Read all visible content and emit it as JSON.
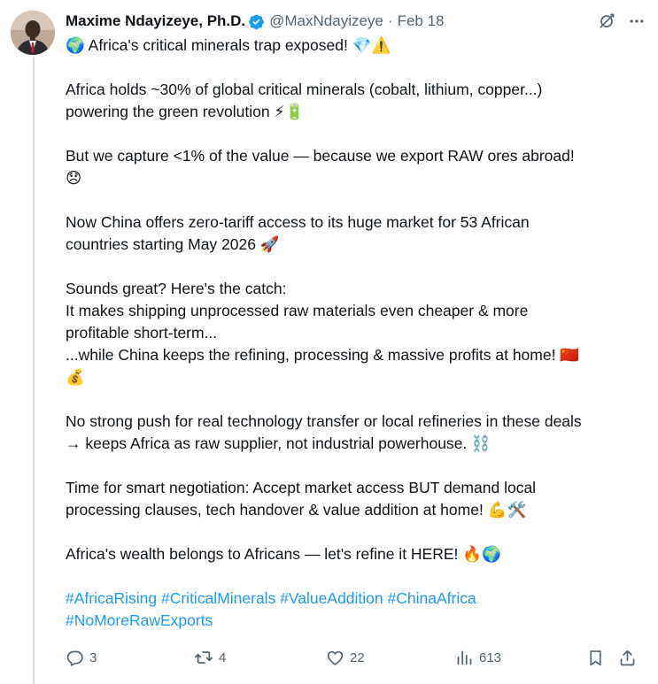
{
  "tweet": {
    "author": {
      "name": "Maxime Ndayizeye, Ph.D.",
      "handle": "@MaxNdayizeye",
      "verified": true
    },
    "separator": "·",
    "date": "Feb 18",
    "paragraphs": [
      [
        "🌍 Africa's critical minerals trap exposed! 💎⚠️"
      ],
      [
        "Africa holds ~30% of global critical minerals (cobalt, lithium, copper...)",
        "powering the green revolution ⚡🔋"
      ],
      [
        "But we capture <1% of the value — because we export RAW ores abroad!",
        "😞"
      ],
      [
        "Now China offers zero-tariff access to its huge market for 53 African",
        "countries starting May 2026 🚀"
      ],
      [
        "Sounds great? Here's the catch:",
        "It makes shipping unprocessed raw materials even cheaper & more",
        "profitable short-term...",
        "...while China keeps the refining, processing & massive profits at home! 🇨🇳",
        "💰"
      ],
      [
        "No strong push for real technology transfer or local refineries in these deals",
        "→ keeps Africa as raw supplier, not industrial powerhouse. ⛓️"
      ],
      [
        "Time for smart negotiation: Accept market access BUT demand local",
        "processing clauses, tech handover & value addition at home! 💪🛠️"
      ],
      [
        "Africa's wealth belongs to Africans — let's refine it HERE! 🔥🌍"
      ]
    ],
    "hashtags": {
      "line1": [
        "#AfricaRising",
        "#CriticalMinerals",
        "#ValueAddition",
        "#ChinaAfrica"
      ],
      "line2": [
        "#NoMoreRawExports"
      ]
    },
    "stats": {
      "replies": "3",
      "reposts": "4",
      "likes": "22",
      "views": "613"
    }
  },
  "icons": {
    "verified": "verified-badge-icon",
    "grok": "grok-icon",
    "more": "more-icon",
    "reply": "reply-icon",
    "repost": "repost-icon",
    "like": "like-icon",
    "views": "views-icon",
    "bookmark": "bookmark-icon",
    "share": "share-icon"
  },
  "colors": {
    "text": "#0f1419",
    "secondary": "#536471",
    "link": "#1d9bf0",
    "verified": "#1d9bf0",
    "thread_line": "#cfd9de"
  }
}
